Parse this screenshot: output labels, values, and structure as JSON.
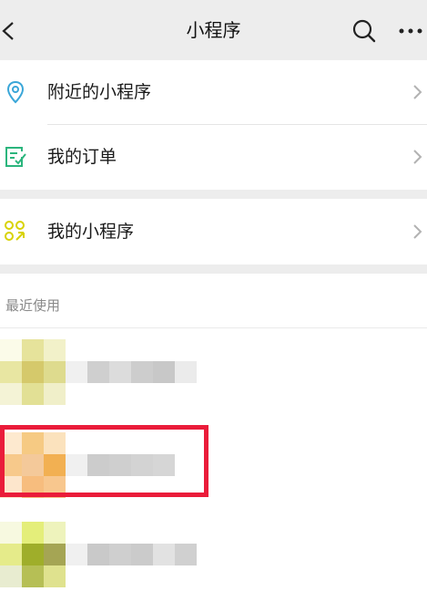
{
  "header": {
    "title": "小程序",
    "back_icon": "chevron-left-icon",
    "search_icon": "search-icon",
    "more_icon": "more-icon"
  },
  "menu": {
    "nearby": {
      "label": "附近的小程序",
      "icon": "location-pin-icon"
    },
    "orders": {
      "label": "我的订单",
      "icon": "order-list-icon"
    },
    "my_apps": {
      "label": "我的小程序",
      "icon": "apps-grid-icon"
    }
  },
  "recent": {
    "title": "最近使用"
  },
  "colors": {
    "accent_pin": "#3aa6d8",
    "accent_order": "#2bb57d",
    "accent_apps": "#d8d200",
    "highlight": "#ea1c3a"
  }
}
